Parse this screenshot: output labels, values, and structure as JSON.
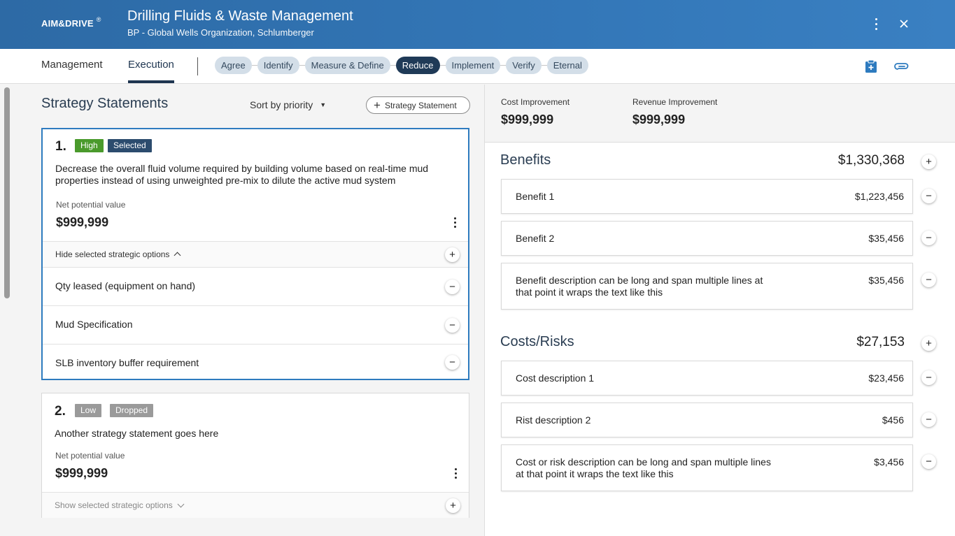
{
  "header": {
    "logo": "AIM&DRIVE",
    "logo_mark": "®",
    "title": "Drilling Fluids & Waste Management",
    "subtitle": "BP - Global Wells Organization, Schlumberger"
  },
  "nav": {
    "tabs": [
      {
        "label": "Management"
      },
      {
        "label": "Execution",
        "active": true
      }
    ],
    "steps": [
      {
        "label": "Agree"
      },
      {
        "label": "Identify"
      },
      {
        "label": "Measure & Define"
      },
      {
        "label": "Reduce",
        "current": true
      },
      {
        "label": "Implement"
      },
      {
        "label": "Verify"
      },
      {
        "label": "Eternal"
      }
    ]
  },
  "left": {
    "title": "Strategy Statements",
    "sort_label": "Sort by priority",
    "add_label": "Strategy Statement",
    "statements": [
      {
        "number": "1.",
        "priority": "High",
        "status": "Selected",
        "text": "Decrease the overall fluid volume required by building volume based on real-time mud properties instead of using unweighted pre-mix to dilute the active mud system",
        "npv_label": "Net potential value",
        "npv_value": "$999,999",
        "toggle_label": "Hide selected strategic options",
        "options": [
          {
            "label": "Qty leased (equipment on hand)"
          },
          {
            "label": "Mud Specification"
          },
          {
            "label": "SLB inventory buffer requirement"
          }
        ]
      },
      {
        "number": "2.",
        "priority": "Low",
        "status": "Dropped",
        "text": "Another strategy statement goes here",
        "npv_label": "Net potential value",
        "npv_value": "$999,999",
        "toggle_label": "Show selected strategic options"
      }
    ]
  },
  "right": {
    "cost_improvement_label": "Cost Improvement",
    "cost_improvement_value": "$999,999",
    "revenue_improvement_label": "Revenue Improvement",
    "revenue_improvement_value": "$999,999",
    "benefits": {
      "title": "Benefits",
      "total": "$1,330,368",
      "items": [
        {
          "desc": "Benefit 1",
          "amount": "$1,223,456"
        },
        {
          "desc": "Benefit 2",
          "amount": "$35,456"
        },
        {
          "desc": "Benefit description can be long and span multiple lines at that point it wraps the text like this",
          "amount": "$35,456"
        }
      ]
    },
    "costs": {
      "title": "Costs/Risks",
      "total": "$27,153",
      "items": [
        {
          "desc": "Cost description 1",
          "amount": "$23,456"
        },
        {
          "desc": "Rist description 2",
          "amount": "$456"
        },
        {
          "desc": "Cost or risk description can be long and span multiple lines at that point it wraps the text like this",
          "amount": "$3,456"
        }
      ]
    }
  },
  "colors": {
    "header_bg": "#3377b8",
    "selected_border": "#2e7bbf",
    "high_badge": "#4a9a2c",
    "selected_badge": "#2c4c6e",
    "muted_badge": "#9a9a9a",
    "current_step": "#1f3a57"
  },
  "icons": [
    "more-vertical-icon",
    "close-icon",
    "clipboard-add-icon",
    "paperclip-icon",
    "plus-icon",
    "minus-icon",
    "chevron-up-icon",
    "chevron-down-icon",
    "caret-down-icon"
  ]
}
